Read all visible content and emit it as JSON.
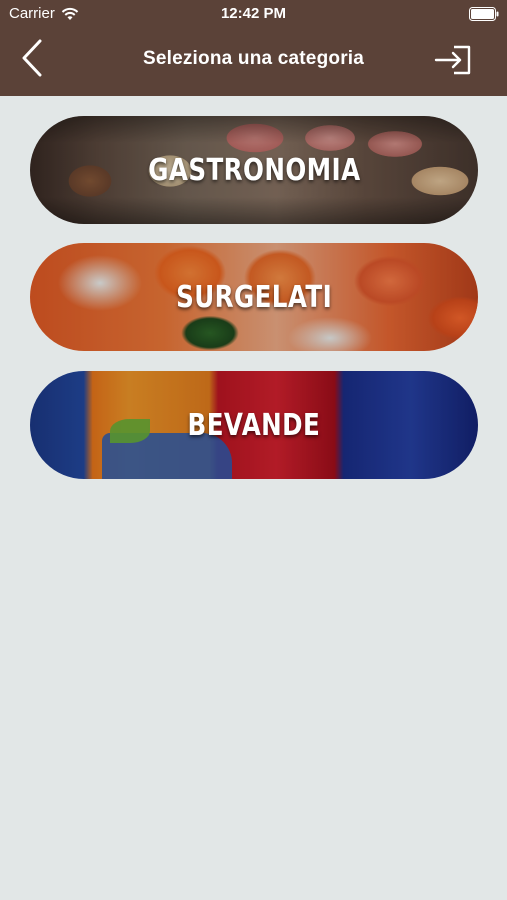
{
  "status_bar": {
    "carrier": "Carrier",
    "time": "12:42 PM",
    "wifi_icon": "wifi-icon",
    "battery_icon": "battery-icon"
  },
  "nav": {
    "title": "Seleziona una categoria",
    "back_icon": "chevron-left-icon",
    "login_icon": "login-icon"
  },
  "colors": {
    "header_bg": "#5b4238",
    "page_bg": "#e2e7e7",
    "label": "#ffffff"
  },
  "categories": [
    {
      "label": "GASTRONOMIA"
    },
    {
      "label": "SURGELATI"
    },
    {
      "label": "BEVANDE"
    }
  ]
}
